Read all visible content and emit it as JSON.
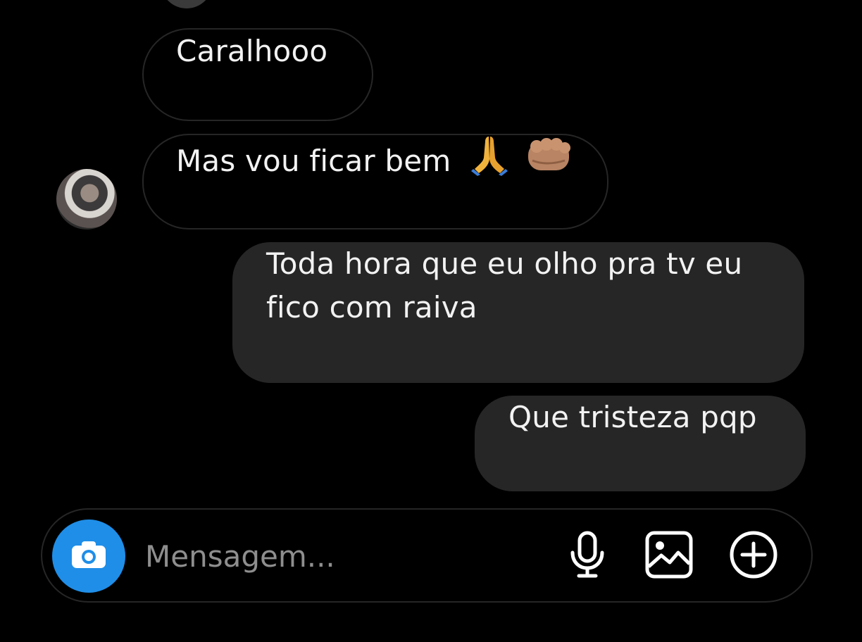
{
  "conversation": {
    "messages": [
      {
        "text": "Caralhooo",
        "direction": "incoming"
      },
      {
        "text": "Mas vou ficar bem",
        "direction": "incoming",
        "emojis": [
          "folded-hands",
          "fist"
        ]
      },
      {
        "text": "Toda hora que eu olho pra tv eu fico com raiva",
        "direction": "outgoing"
      },
      {
        "text": "Que tristeza pqp",
        "direction": "outgoing"
      }
    ]
  },
  "composer": {
    "placeholder": "Mensagem...",
    "icons": [
      "camera-icon",
      "microphone-icon",
      "gallery-icon",
      "plus-circle-icon"
    ]
  },
  "colors": {
    "background": "#000000",
    "outgoing_bubble": "#262626",
    "incoming_border": "#262626",
    "camera_accent": "#1f8ee8",
    "placeholder_text": "#8e8e8e"
  }
}
